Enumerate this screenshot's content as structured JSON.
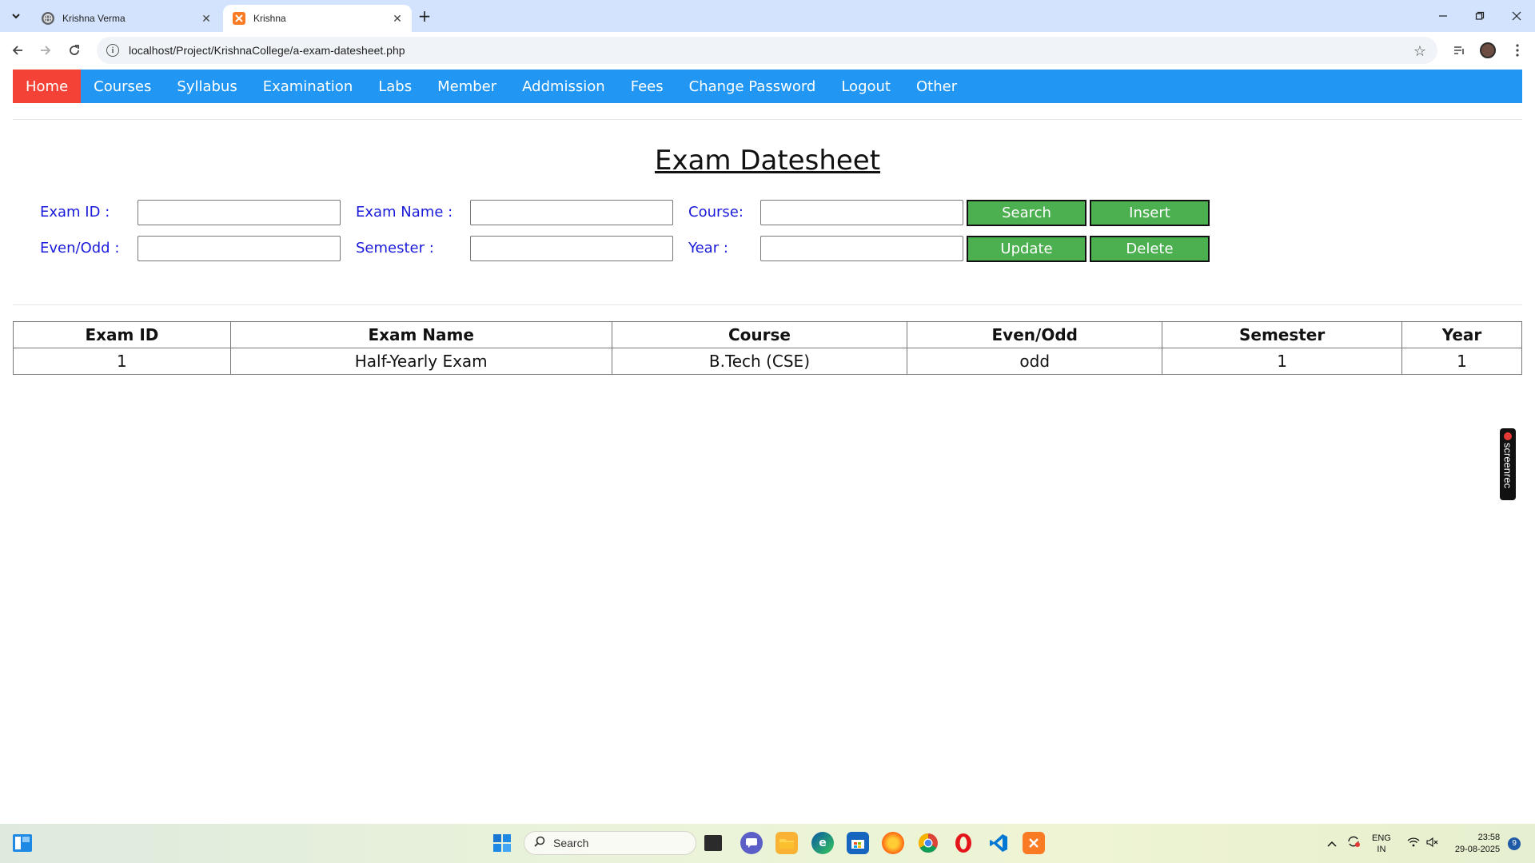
{
  "browser": {
    "tabs": [
      {
        "title": "Krishna Verma",
        "active": false
      },
      {
        "title": "Krishna",
        "active": true
      }
    ],
    "new_tab": "+",
    "url": "localhost/Project/KrishnaCollege/a-exam-datesheet.php"
  },
  "navbar": {
    "items": [
      "Home",
      "Courses",
      "Syllabus",
      "Examination",
      "Labs",
      "Member",
      "Addmission",
      "Fees",
      "Change Password",
      "Logout",
      "Other"
    ],
    "active": "Home",
    "color": "#2196F3",
    "active_color": "#f44336"
  },
  "page": {
    "title": "Exam Datesheet"
  },
  "form": {
    "exam_id_label": "Exam ID :",
    "exam_name_label": "Exam Name :",
    "course_label": "Course:",
    "even_odd_label": "Even/Odd :",
    "semester_label": "Semester :",
    "year_label": "Year :",
    "exam_id_value": "",
    "exam_name_value": "",
    "course_value": "",
    "even_odd_value": "",
    "semester_value": "",
    "year_value": ""
  },
  "buttons": {
    "search": "Search",
    "insert": "Insert",
    "update": "Update",
    "delete": "Delete",
    "color": "#4CAF50"
  },
  "table": {
    "headers": [
      "Exam ID",
      "Exam Name",
      "Course",
      "Even/Odd",
      "Semester",
      "Year"
    ],
    "rows": [
      [
        "1",
        "Half-Yearly Exam",
        "B.Tech (CSE)",
        "odd",
        "1",
        "1"
      ]
    ]
  },
  "overlay": {
    "screenrec": "screenrec"
  },
  "taskbar": {
    "search_label": "Search",
    "lang_top": "ENG",
    "lang_bottom": "IN",
    "time": "23:58",
    "date": "29-08-2025",
    "notification_count": "9"
  }
}
